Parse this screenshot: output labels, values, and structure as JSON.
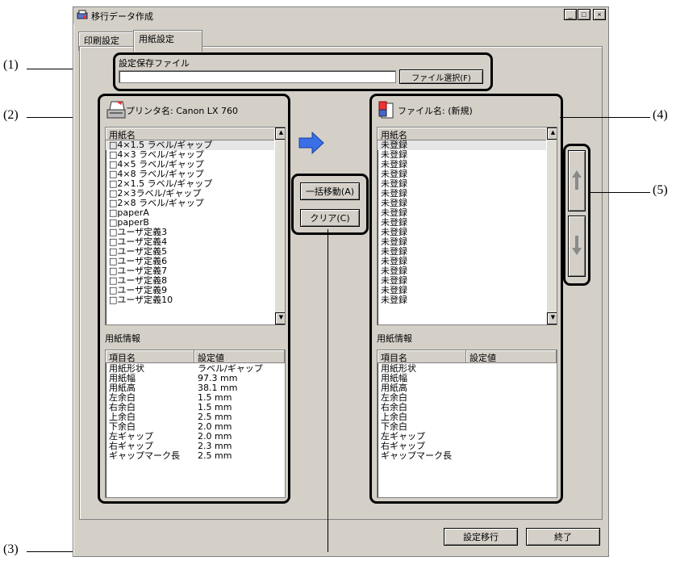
{
  "window": {
    "title": "移行データ作成",
    "minimize": "_",
    "maximize": "□",
    "close": "×"
  },
  "tabs": [
    "印刷設定",
    "用紙設定"
  ],
  "save_file": {
    "label": "設定保存ファイル",
    "value": "",
    "button": "ファイル選択(F)"
  },
  "left": {
    "printer_label": "プリンタ名:",
    "printer_name": "Canon LX 760",
    "list_header": "用紙名",
    "items": [
      "□4×1.5 ラベル/ギャップ",
      "□4×3 ラベル/ギャップ",
      "□4×5 ラベル/ギャップ",
      "□4×8 ラベル/ギャップ",
      "□2×1.5 ラベル/ギャップ",
      "□2×3ラベル/ギャップ",
      "□2×8 ラベル/ギャップ",
      "□paperA",
      "□paperB",
      "□ユーザ定義3",
      "□ユーザ定義4",
      "□ユーザ定義5",
      "□ユーザ定義6",
      "□ユーザ定義7",
      "□ユーザ定義8",
      "□ユーザ定義9",
      "□ユーザ定義10"
    ],
    "info_label": "用紙情報",
    "info_headers": [
      "項目名",
      "設定値"
    ],
    "info_rows": [
      [
        "用紙形状",
        "ラベル/ギャップ"
      ],
      [
        "用紙幅",
        "97.3 mm"
      ],
      [
        "用紙高",
        "38.1 mm"
      ],
      [
        "左余白",
        "1.5 mm"
      ],
      [
        "右余白",
        "1.5 mm"
      ],
      [
        "上余白",
        "2.5 mm"
      ],
      [
        "下余白",
        "2.0 mm"
      ],
      [
        "左ギャップ",
        "2.0 mm"
      ],
      [
        "右ギャップ",
        "2.3 mm"
      ],
      [
        "ギャップマーク長",
        "2.5 mm"
      ]
    ]
  },
  "middle": {
    "move_all": "一括移動(A)",
    "clear": "クリア(C)"
  },
  "right": {
    "file_label": "ファイル名:",
    "file_name": "(新規)",
    "list_header": "用紙名",
    "items": [
      "未登録",
      "未登録",
      "未登録",
      "未登録",
      "未登録",
      "未登録",
      "未登録",
      "未登録",
      "未登録",
      "未登録",
      "未登録",
      "未登録",
      "未登録",
      "未登録",
      "未登録",
      "未登録",
      "未登録"
    ],
    "info_label": "用紙情報",
    "info_headers": [
      "項目名",
      "設定値"
    ],
    "info_rows": [
      [
        "用紙形状",
        ""
      ],
      [
        "用紙幅",
        ""
      ],
      [
        "用紙高",
        ""
      ],
      [
        "左余白",
        ""
      ],
      [
        "右余白",
        ""
      ],
      [
        "上余白",
        ""
      ],
      [
        "下余白",
        ""
      ],
      [
        "左ギャップ",
        ""
      ],
      [
        "右ギャップ",
        ""
      ],
      [
        "ギャップマーク長",
        ""
      ]
    ]
  },
  "bottom": {
    "migrate": "設定移行",
    "exit": "終了"
  },
  "callouts": [
    "(1)",
    "(2)",
    "(3)",
    "(4)",
    "(5)"
  ],
  "colors": {
    "window_bg": "#d4d0c8",
    "arrow": "#3a6fe6",
    "updown_arrow": "#8a8a8a"
  }
}
